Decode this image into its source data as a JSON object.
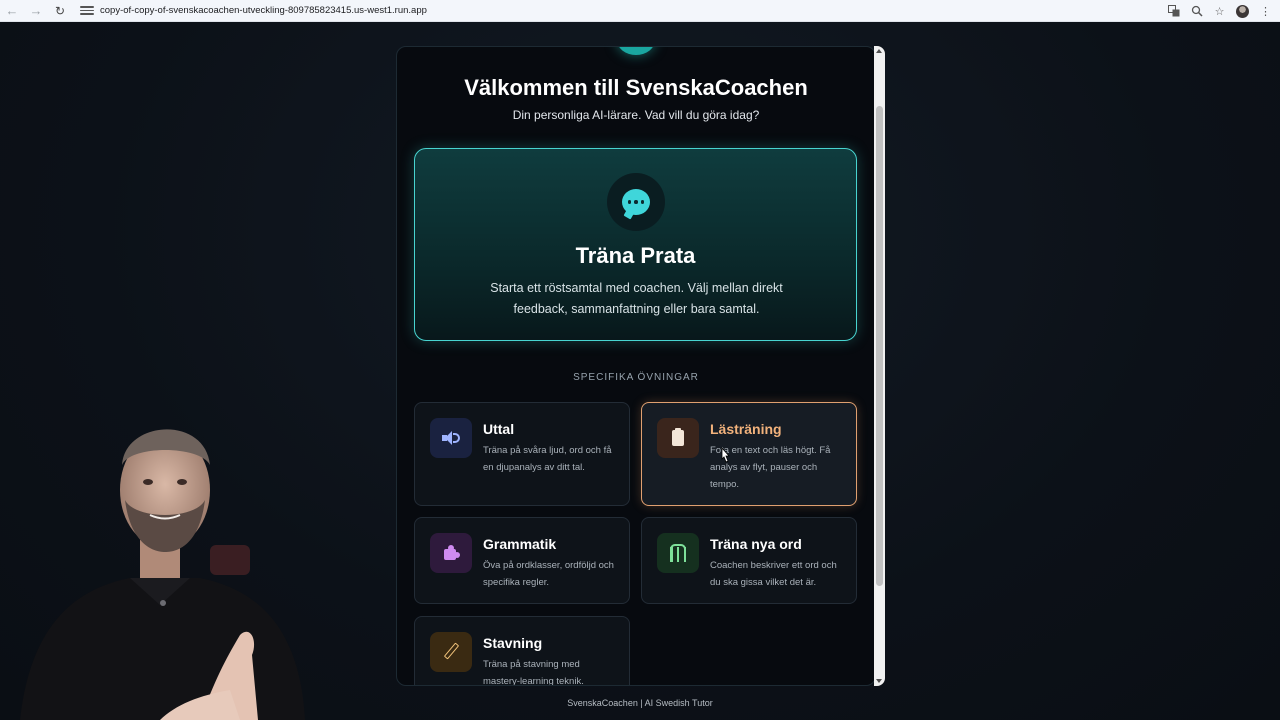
{
  "browser": {
    "url": "copy-of-copy-of-svenskacoachen-utveckling-809785823415.us-west1.run.app"
  },
  "header": {
    "title": "Välkommen till SvenskaCoachen",
    "subtitle": "Din personliga AI-lärare. Vad vill du göra idag?"
  },
  "hero": {
    "title": "Träna Prata",
    "description": "Starta ett röstsamtal med coachen. Välj mellan direkt feedback, sammanfattning eller bara samtal.",
    "icon": "chat-bubble-icon"
  },
  "exercises_section": {
    "heading": "SPECIFIKA ÖVNINGAR",
    "items": [
      {
        "title": "Uttal",
        "description": "Träna på svåra ljud, ord och få en djupanalys av ditt tal.",
        "icon": "speaker-icon"
      },
      {
        "title": "Lästräning",
        "description": "Fota en text och läs högt. Få analys av flyt, pauser och tempo.",
        "icon": "clipboard-icon"
      },
      {
        "title": "Grammatik",
        "description": "Öva på ordklasser, ordföljd och specifika regler.",
        "icon": "puzzle-icon"
      },
      {
        "title": "Träna nya ord",
        "description": "Coachen beskriver ett ord och du ska gissa vilket det är.",
        "icon": "vocabulary-icon"
      },
      {
        "title": "Stavning",
        "description": "Träna på stavning med mastery-learning teknik.",
        "icon": "pencil-icon"
      }
    ]
  },
  "footer": {
    "text": "SvenskaCoachen | AI Swedish Tutor"
  },
  "colors": {
    "accent_teal": "#48d4d0",
    "highlight_orange": "#e0a070",
    "panel_background": "#070a0f",
    "page_background": "#0d121a"
  }
}
